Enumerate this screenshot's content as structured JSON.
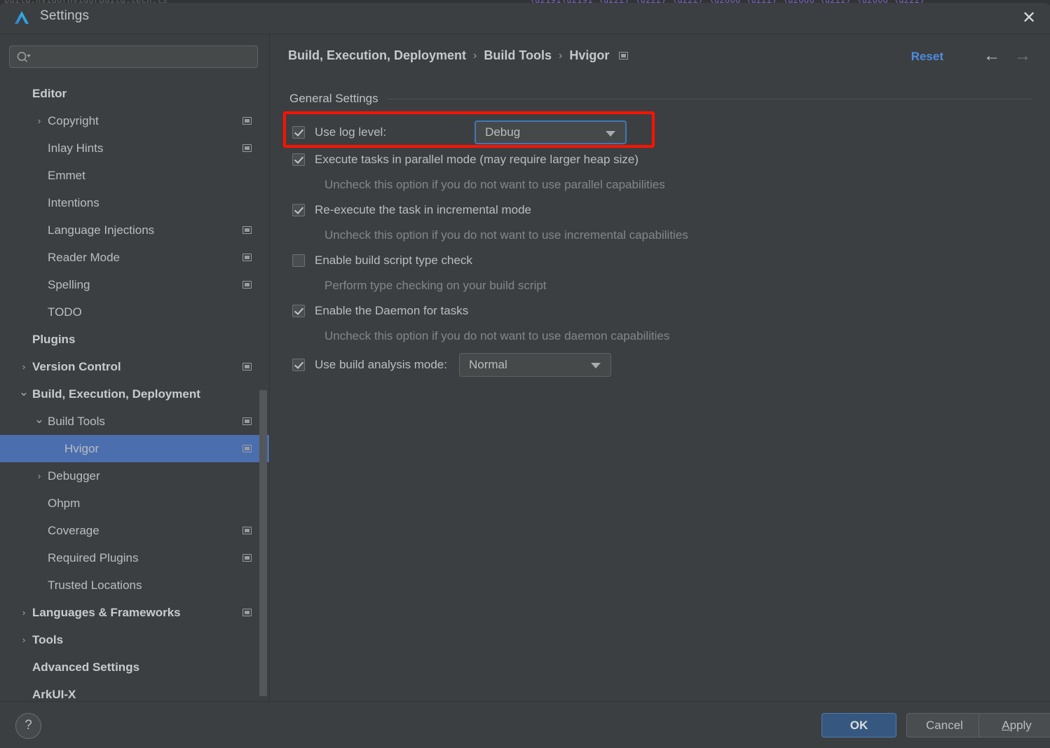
{
  "window": {
    "title": "Settings",
    "app_icon": "deveco-logo-icon",
    "close_label": "✕"
  },
  "search": {
    "placeholder": "",
    "value": "",
    "icon": "search-icon"
  },
  "sidebar": {
    "items": [
      {
        "label": "Editor",
        "indent": 0,
        "arrow": "",
        "bold": true,
        "ext": false,
        "selected": false
      },
      {
        "label": "Copyright",
        "indent": 1,
        "arrow": "›",
        "bold": false,
        "ext": true,
        "selected": false
      },
      {
        "label": "Inlay Hints",
        "indent": 1,
        "arrow": "",
        "bold": false,
        "ext": true,
        "selected": false
      },
      {
        "label": "Emmet",
        "indent": 1,
        "arrow": "",
        "bold": false,
        "ext": false,
        "selected": false
      },
      {
        "label": "Intentions",
        "indent": 1,
        "arrow": "",
        "bold": false,
        "ext": false,
        "selected": false
      },
      {
        "label": "Language Injections",
        "indent": 1,
        "arrow": "",
        "bold": false,
        "ext": true,
        "selected": false
      },
      {
        "label": "Reader Mode",
        "indent": 1,
        "arrow": "",
        "bold": false,
        "ext": true,
        "selected": false
      },
      {
        "label": "Spelling",
        "indent": 1,
        "arrow": "",
        "bold": false,
        "ext": true,
        "selected": false
      },
      {
        "label": "TODO",
        "indent": 1,
        "arrow": "",
        "bold": false,
        "ext": false,
        "selected": false
      },
      {
        "label": "Plugins",
        "indent": 0,
        "arrow": "",
        "bold": true,
        "ext": false,
        "selected": false
      },
      {
        "label": "Version Control",
        "indent": 0,
        "arrow": "›",
        "bold": true,
        "ext": true,
        "selected": false
      },
      {
        "label": "Build, Execution, Deployment",
        "indent": 0,
        "arrow": "⌄",
        "bold": true,
        "ext": false,
        "selected": false
      },
      {
        "label": "Build Tools",
        "indent": 1,
        "arrow": "⌄",
        "bold": false,
        "ext": true,
        "selected": false
      },
      {
        "label": "Hvigor",
        "indent": 2,
        "arrow": "",
        "bold": false,
        "ext": true,
        "selected": true
      },
      {
        "label": "Debugger",
        "indent": 1,
        "arrow": "›",
        "bold": false,
        "ext": false,
        "selected": false
      },
      {
        "label": "Ohpm",
        "indent": 1,
        "arrow": "",
        "bold": false,
        "ext": false,
        "selected": false
      },
      {
        "label": "Coverage",
        "indent": 1,
        "arrow": "",
        "bold": false,
        "ext": true,
        "selected": false
      },
      {
        "label": "Required Plugins",
        "indent": 1,
        "arrow": "",
        "bold": false,
        "ext": true,
        "selected": false
      },
      {
        "label": "Trusted Locations",
        "indent": 1,
        "arrow": "",
        "bold": false,
        "ext": false,
        "selected": false
      },
      {
        "label": "Languages & Frameworks",
        "indent": 0,
        "arrow": "›",
        "bold": true,
        "ext": true,
        "selected": false
      },
      {
        "label": "Tools",
        "indent": 0,
        "arrow": "›",
        "bold": true,
        "ext": false,
        "selected": false
      },
      {
        "label": "Advanced Settings",
        "indent": 0,
        "arrow": "",
        "bold": true,
        "ext": false,
        "selected": false
      },
      {
        "label": "ArkUI-X",
        "indent": 0,
        "arrow": "",
        "bold": true,
        "ext": false,
        "selected": false
      }
    ],
    "selection_color": "#4b6eaf"
  },
  "header": {
    "breadcrumb": [
      "Build, Execution, Deployment",
      "Build Tools",
      "Hvigor"
    ],
    "separator": "›",
    "ext_icon": "external-link-icon",
    "reset_label": "Reset",
    "reset_color": "#4d8ce0",
    "back_icon": "←",
    "forward_icon": "→"
  },
  "main": {
    "group_title": "General Settings",
    "log_level": {
      "label": "Use log level:",
      "checked": true,
      "value": "Debug",
      "focused": true,
      "highlighted": true,
      "highlight_color": "#ff1200"
    },
    "options": [
      {
        "label": "Execute tasks in parallel mode (may require larger heap size)",
        "checked": true,
        "description": "Uncheck this option if you do not want to use parallel capabilities"
      },
      {
        "label": "Re-execute the task in incremental mode",
        "checked": true,
        "description": "Uncheck this option if you do not want to use incremental capabilities"
      },
      {
        "label": "Enable build script type check",
        "checked": false,
        "description": "Perform type checking on your build script"
      },
      {
        "label": "Enable the Daemon for tasks",
        "checked": true,
        "description": "Uncheck this option if you do not want to use daemon capabilities"
      }
    ],
    "build_analysis": {
      "label": "Use build analysis mode:",
      "checked": true,
      "value": "Normal"
    }
  },
  "footer": {
    "help_label": "?",
    "ok_label": "OK",
    "cancel_label": "Cancel",
    "apply_mnemonic": "A",
    "apply_rest": "pply"
  }
}
